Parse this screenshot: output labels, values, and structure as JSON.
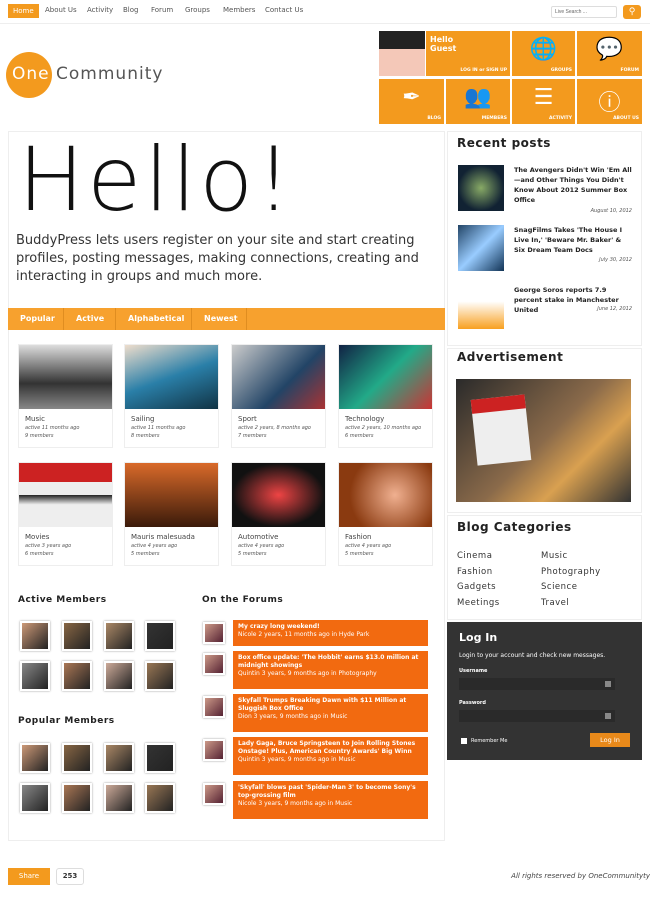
{
  "nav": {
    "items": [
      "Home",
      "About Us",
      "Activity",
      "Blog",
      "Forum",
      "Groups",
      "Members",
      "Contact Us"
    ],
    "search_placeholder": "Live Search ..."
  },
  "logo": {
    "one": "One",
    "community": "Community"
  },
  "tiles": {
    "hello": "Hello Guest",
    "login": "LOG IN or SIGN UP",
    "groups": "GROUPS",
    "forum": "FORUM",
    "blog": "BLOG",
    "members": "MEMBERS",
    "activity": "ACTIVITY",
    "about": "ABOUT US"
  },
  "hero": {
    "title": "Hello!",
    "text": "BuddyPress lets users register on your site and start creating profiles, posting messages, making connections, creating and interacting in groups and much more."
  },
  "tabs": [
    "Popular",
    "Active",
    "Alphabetical",
    "Newest"
  ],
  "groups": [
    {
      "name": "Music",
      "active": "active 11 months ago",
      "members": "9 members"
    },
    {
      "name": "Sailing",
      "active": "active 11 months ago",
      "members": "8 members"
    },
    {
      "name": "Sport",
      "active": "active 2 years, 8 months ago",
      "members": "7 members"
    },
    {
      "name": "Technology",
      "active": "active 2 years, 10 months ago",
      "members": "6 members"
    },
    {
      "name": "Movies",
      "active": "active 3 years ago",
      "members": "6 members"
    },
    {
      "name": "Mauris malesuada",
      "active": "active 4 years ago",
      "members": "5 members"
    },
    {
      "name": "Automotive",
      "active": "active 4 years ago",
      "members": "5 members"
    },
    {
      "name": "Fashion",
      "active": "active 4 years ago",
      "members": "5 members"
    }
  ],
  "active_members": {
    "title": "Active Members"
  },
  "popular_members": {
    "title": "Popular Members"
  },
  "forums": {
    "title": "On the Forums",
    "items": [
      {
        "title": "My crazy long weekend!",
        "meta": "Nicole 2 years, 11 months ago in Hyde Park"
      },
      {
        "title": "Box office update: 'The Hobbit' earns $13.0 million at midnight showings",
        "meta": "Quintin 3 years, 9 months ago in Photography"
      },
      {
        "title": "Skyfall Trumps Breaking Dawn with $11 Million at Sluggish Box Office",
        "meta": "Dion 3 years, 9 months ago in Music"
      },
      {
        "title": "Lady Gaga, Bruce Springsteen to Join Rolling Stones Onstage! Plus, American Country Awards' Big Winn",
        "meta": "Quintin 3 years, 9 months ago in Music"
      },
      {
        "title": "'Skyfall' blows past 'Spider-Man 3' to become Sony's top-grossing film",
        "meta": "Nicole 3 years, 9 months ago in Music"
      }
    ]
  },
  "recent": {
    "title": "Recent posts",
    "items": [
      {
        "title": "The Avengers Didn't Win 'Em All—and Other Things You Didn't Know About 2012 Summer Box Office",
        "date": "August 10, 2012"
      },
      {
        "title": "SnagFilms Takes 'The House I Live In,' 'Beware Mr. Baker' & Six Dream Team Docs",
        "date": "July 30, 2012"
      },
      {
        "title": "George Soros reports 7.9 percent stake in Manchester United",
        "date": "June 12, 2012"
      }
    ]
  },
  "ad": {
    "title": "Advertisement"
  },
  "categories": {
    "title": "Blog Categories",
    "items": [
      "Cinema",
      "Music",
      "Fashion",
      "Photography",
      "Gadgets",
      "Science",
      "Meetings",
      "Travel"
    ]
  },
  "login": {
    "title": "Log In",
    "subtitle": "Login to your account and check new messages.",
    "username": "Username",
    "password": "Password",
    "remember": "Remember Me",
    "button": "Log In"
  },
  "footer": {
    "share": "Share",
    "count": "253",
    "rights": "All rights reserved by OneCommunityty"
  },
  "colors": {
    "accent": "#f39a1e",
    "forum": "#f26a10",
    "login_bg": "#333333"
  }
}
